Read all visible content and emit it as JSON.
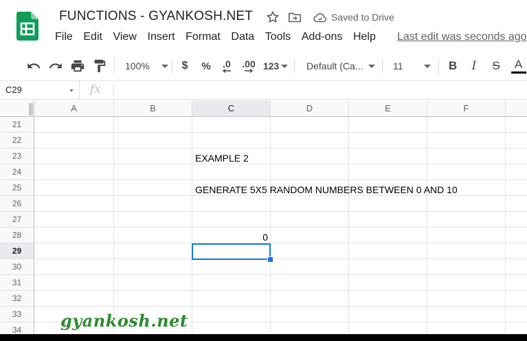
{
  "doc": {
    "title": "FUNCTIONS - GYANKOSH.NET",
    "saved_status": "Saved to Drive",
    "last_edit": "Last edit was seconds ago"
  },
  "menu": [
    "File",
    "Edit",
    "View",
    "Insert",
    "Format",
    "Data",
    "Tools",
    "Add-ons",
    "Help"
  ],
  "toolbar": {
    "zoom": "100%",
    "currency": "$",
    "percent": "%",
    "decrease_decimals": ".0",
    "increase_decimals": ".00",
    "more_formats": "123",
    "font_family": "Default (Ca...",
    "font_size": "11",
    "bold": "B",
    "italic": "I",
    "strike": "S",
    "text_color": "A"
  },
  "formula_bar": {
    "name_box": "C29",
    "fx": "fx",
    "value": ""
  },
  "grid": {
    "columns": [
      "A",
      "B",
      "C",
      "D",
      "E",
      "F"
    ],
    "selected_column": "C",
    "rows": [
      "21",
      "22",
      "23",
      "24",
      "25",
      "26",
      "27",
      "28",
      "29",
      "30",
      "31",
      "32",
      "33",
      "34"
    ],
    "selected_row": "29",
    "cells": {
      "C23": "EXAMPLE 2",
      "C25": "GENERATE 5X5 RANDOM NUMBERS BETWEEN 0 AND 10",
      "C28": "0"
    },
    "selected_cell": "C29"
  },
  "watermark": "gyankosh.net",
  "colors": {
    "selection": "#1a73e8",
    "sheets_green": "#0f9d58",
    "watermark": "#2e8b2e"
  }
}
